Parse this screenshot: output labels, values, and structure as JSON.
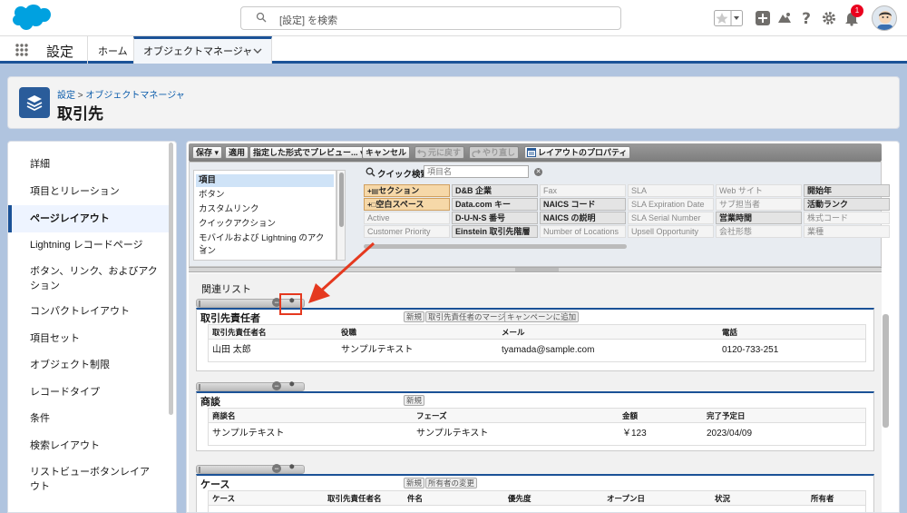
{
  "topbar": {
    "search_placeholder": "[設定] を検索",
    "notification_count": "1",
    "icons": [
      "favorite-star-icon",
      "favorites-dropdown-icon",
      "add-icon",
      "trailhead-icon",
      "help-icon",
      "setup-gear-icon",
      "notification-bell-icon"
    ]
  },
  "nav": {
    "app_name": "設定",
    "home": "ホーム",
    "object_manager": "オブジェクトマネージャ"
  },
  "header": {
    "breadcrumb_setup": "設定",
    "breadcrumb_sep": ">",
    "breadcrumb_object_manager": "オブジェクトマネージャ",
    "title": "取引先"
  },
  "sidebar": {
    "items": [
      {
        "label": "詳細"
      },
      {
        "label": "項目とリレーション"
      },
      {
        "label": "ページレイアウト"
      },
      {
        "label": "Lightning レコードページ"
      },
      {
        "label": "ボタン、リンク、およびアク"
      },
      {
        "label": "ション"
      },
      {
        "label": "コンパクトレイアウト"
      },
      {
        "label": "項目セット"
      },
      {
        "label": "オブジェクト制限"
      },
      {
        "label": "レコードタイプ"
      },
      {
        "label": "条件"
      },
      {
        "label": "検索レイアウト"
      },
      {
        "label": "リストビューボタンレイア"
      },
      {
        "label": "ウト"
      }
    ]
  },
  "toolbar": {
    "save": "保存 ▾",
    "apply": "適用",
    "preview": "指定した形式でプレビュー... ▾",
    "cancel": "キャンセル",
    "undo": "元に戻す",
    "redo": "やり直し",
    "layout_props": "レイアウトのプロパティ"
  },
  "palette": {
    "categories": [
      "項目",
      "ボタン",
      "カスタムリンク",
      "クイックアクション",
      "モバイルおよび Lightning のアクシ",
      "ョン"
    ],
    "quick_find_label": "クイック検索",
    "quick_find_placeholder": "項目名",
    "fields": [
      [
        "セクション",
        "D&B 企業",
        "Fax",
        "SLA",
        "Web サイト",
        "開始年"
      ],
      [
        "空白スペース",
        "Data.com キー",
        "NAICS コード",
        "SLA Expiration Date",
        "サブ担当者",
        "活動ランク"
      ],
      [
        "Active",
        "D-U-N-S 番号",
        "NAICS の説明",
        "SLA Serial Number",
        "営業時間",
        "株式コード"
      ],
      [
        "Customer Priority",
        "Einstein 取引先階層",
        "Number of Locations",
        "Upsell Opportunity",
        "会社形態",
        "業種"
      ]
    ]
  },
  "related": {
    "title": "関連リスト",
    "contacts": {
      "name": "取引先責任者",
      "buttons": [
        "新規",
        "取引先責任者のマージ",
        "キャンペーンに追加"
      ],
      "headers": [
        "取引先責任者名",
        "役職",
        "メール",
        "電話"
      ],
      "row": [
        "山田 太郎",
        "サンプルテキスト",
        "tyamada@sample.com",
        "0120-733-251"
      ]
    },
    "opportunities": {
      "name": "商談",
      "buttons": [
        "新規"
      ],
      "headers": [
        "商談名",
        "フェーズ",
        "金額",
        "完了予定日"
      ],
      "row": [
        "サンプルテキスト",
        "サンプルテキスト",
        "￥123",
        "2023/04/09"
      ]
    },
    "cases": {
      "name": "ケース",
      "buttons": [
        "新規",
        "所有者の変更"
      ],
      "headers": [
        "ケース",
        "取引先責任者名",
        "件名",
        "優先度",
        "オープン日",
        "状況",
        "所有者"
      ]
    }
  },
  "colors": {
    "brand": "#1b5297",
    "highlight": "#e5391f",
    "salesforce_blue": "#00a1e0"
  }
}
